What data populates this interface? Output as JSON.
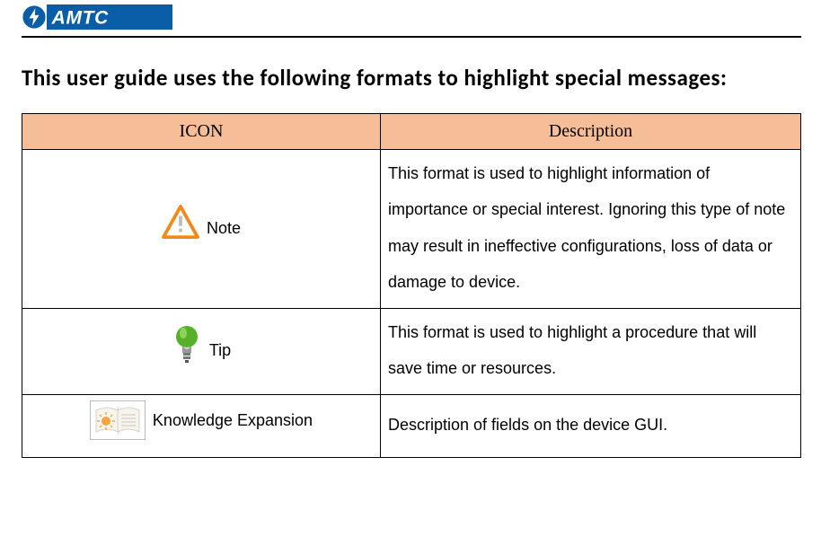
{
  "brand": "AMTC",
  "heading": "This user guide uses the following formats to highlight special messages:",
  "table": {
    "headers": {
      "icon": "ICON",
      "desc": "Description"
    },
    "rows": [
      {
        "icon_name": "note-icon",
        "label": "Note",
        "description": "This format is used to highlight information of importance or special interest. Ignoring this type of note may result in ineffective configurations, loss of data or damage to device."
      },
      {
        "icon_name": "tip-icon",
        "label": "Tip",
        "description": "This format is used to highlight a procedure that will save time or resources."
      },
      {
        "icon_name": "knowledge-expansion-icon",
        "label": "Knowledge Expansion",
        "description": "Description of fields on the device GUI."
      }
    ]
  }
}
